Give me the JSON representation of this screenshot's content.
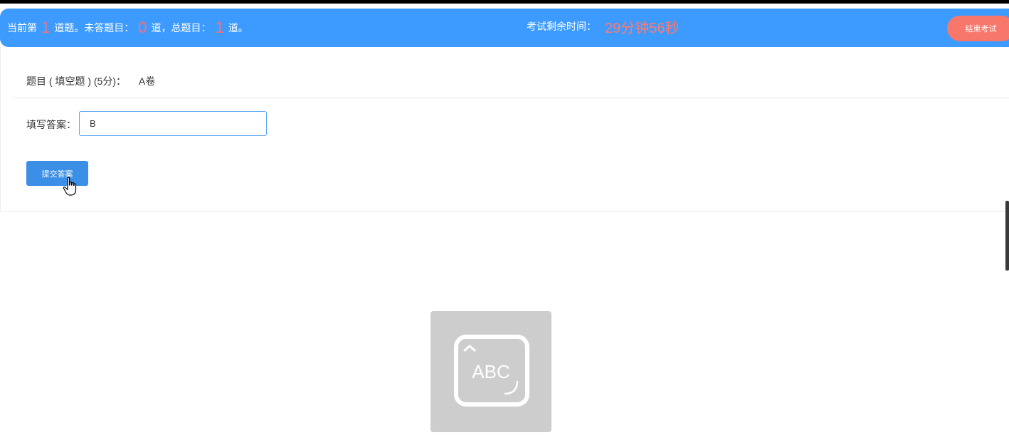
{
  "header": {
    "status": {
      "current_prefix": "当前第",
      "current_num": "1",
      "unanswered_prefix": "道题。未答题目：",
      "unanswered_num": "0",
      "total_prefix": "道，总题目：",
      "total_num": "1",
      "total_suffix": "道。"
    },
    "timer_label": "考试剩余时间：",
    "timer_value": "29分钟56秒",
    "end_button": "结束考试"
  },
  "question": {
    "title": "题目 ( 填空题 ) (5分)：",
    "content": "A卷"
  },
  "answer": {
    "label": "填写答案：",
    "value": "B"
  },
  "submit_button": "提交答案",
  "image_placeholder": {
    "icon": "keyboard-abc-icon",
    "text": "ABC"
  },
  "colors": {
    "header_bg": "#3d9bff",
    "accent_red": "#ff6e6e",
    "end_button_bg": "#f8776b",
    "submit_bg": "#3b8fe6"
  }
}
